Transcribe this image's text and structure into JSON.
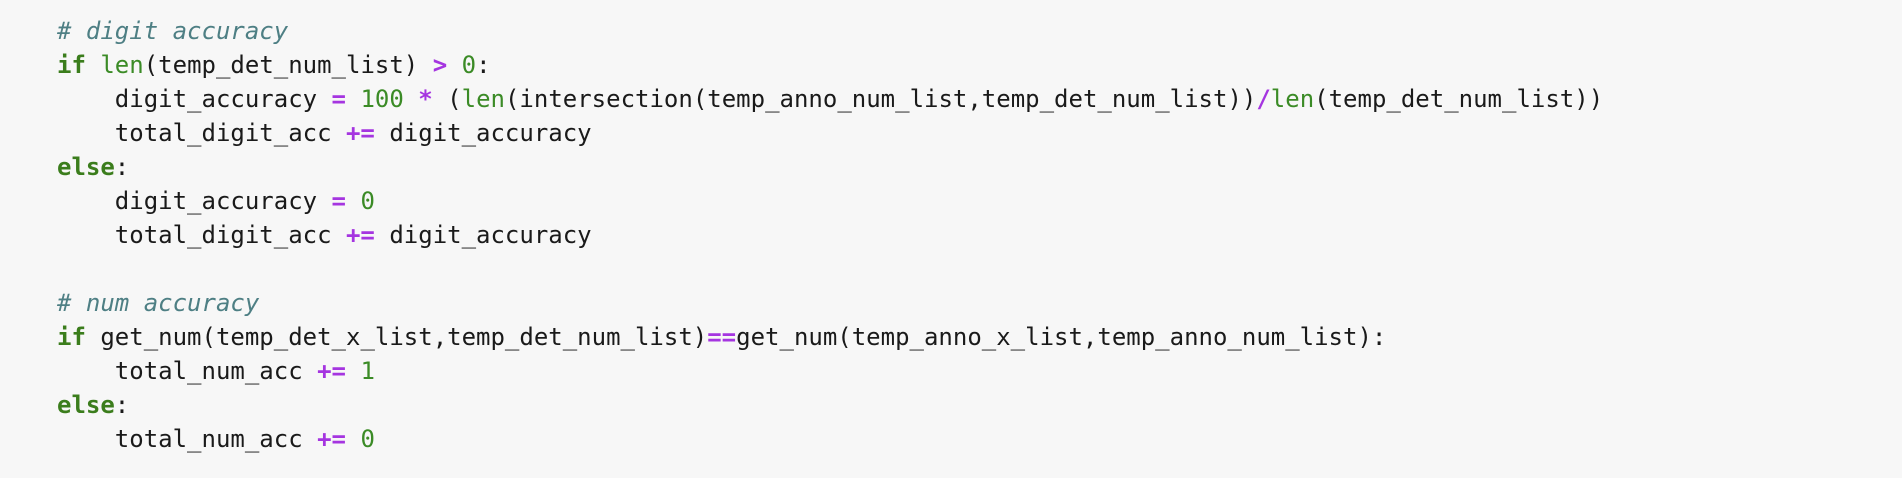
{
  "colors": {
    "background": "#f7f7f7",
    "keyword": "#3b7d1c",
    "builtin": "#3b8b26",
    "operator": "#a535e0",
    "number": "#3b8b26",
    "comment": "#4e7f84",
    "text": "#1a1a1a"
  },
  "code": {
    "lines": [
      [
        {
          "t": "comment",
          "v": "# digit accuracy"
        }
      ],
      [
        {
          "t": "kw",
          "v": "if"
        },
        {
          "t": "plain",
          "v": " "
        },
        {
          "t": "builtin",
          "v": "len"
        },
        {
          "t": "plain",
          "v": "(temp_det_num_list) "
        },
        {
          "t": "op",
          "v": ">"
        },
        {
          "t": "plain",
          "v": " "
        },
        {
          "t": "num",
          "v": "0"
        },
        {
          "t": "plain",
          "v": ":"
        }
      ],
      [
        {
          "t": "plain",
          "v": "    digit_accuracy "
        },
        {
          "t": "op",
          "v": "="
        },
        {
          "t": "plain",
          "v": " "
        },
        {
          "t": "num",
          "v": "100"
        },
        {
          "t": "plain",
          "v": " "
        },
        {
          "t": "op",
          "v": "*"
        },
        {
          "t": "plain",
          "v": " ("
        },
        {
          "t": "builtin",
          "v": "len"
        },
        {
          "t": "plain",
          "v": "(intersection(temp_anno_num_list,temp_det_num_list))"
        },
        {
          "t": "op",
          "v": "/"
        },
        {
          "t": "builtin",
          "v": "len"
        },
        {
          "t": "plain",
          "v": "(temp_det_num_list))"
        }
      ],
      [
        {
          "t": "plain",
          "v": "    total_digit_acc "
        },
        {
          "t": "op",
          "v": "+="
        },
        {
          "t": "plain",
          "v": " digit_accuracy"
        }
      ],
      [
        {
          "t": "kw",
          "v": "else"
        },
        {
          "t": "plain",
          "v": ":"
        }
      ],
      [
        {
          "t": "plain",
          "v": "    digit_accuracy "
        },
        {
          "t": "op",
          "v": "="
        },
        {
          "t": "plain",
          "v": " "
        },
        {
          "t": "num",
          "v": "0"
        }
      ],
      [
        {
          "t": "plain",
          "v": "    total_digit_acc "
        },
        {
          "t": "op",
          "v": "+="
        },
        {
          "t": "plain",
          "v": " digit_accuracy"
        }
      ],
      [],
      [
        {
          "t": "comment",
          "v": "# num accuracy"
        }
      ],
      [
        {
          "t": "kw",
          "v": "if"
        },
        {
          "t": "plain",
          "v": " get_num(temp_det_x_list,temp_det_num_list)"
        },
        {
          "t": "op",
          "v": "=="
        },
        {
          "t": "plain",
          "v": "get_num(temp_anno_x_list,temp_anno_num_list):"
        }
      ],
      [
        {
          "t": "plain",
          "v": "    total_num_acc "
        },
        {
          "t": "op",
          "v": "+="
        },
        {
          "t": "plain",
          "v": " "
        },
        {
          "t": "num",
          "v": "1"
        }
      ],
      [
        {
          "t": "kw",
          "v": "else"
        },
        {
          "t": "plain",
          "v": ":"
        }
      ],
      [
        {
          "t": "plain",
          "v": "    total_num_acc "
        },
        {
          "t": "op",
          "v": "+="
        },
        {
          "t": "plain",
          "v": " "
        },
        {
          "t": "num",
          "v": "0"
        }
      ]
    ]
  }
}
